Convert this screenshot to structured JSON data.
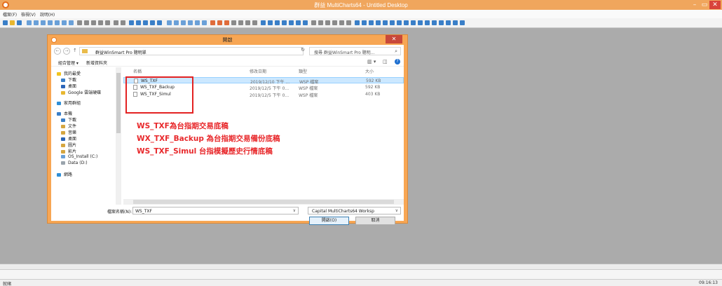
{
  "app": {
    "title": "群益 MultiCharts64 - Untitled Desktop",
    "minimize": "–",
    "maximize": "▭",
    "close": "✕"
  },
  "menubar": [
    "檔案(F)",
    "檢視(V)",
    "說明(H)"
  ],
  "dialog": {
    "title": "開啟",
    "close": "✕",
    "address": {
      "back": "←",
      "forward": "→",
      "up": "↑",
      "path": "群益WinSmart Pro 聰明單",
      "dropdown": "∨",
      "refresh": "↻",
      "search_placeholder": "搜尋 群益WinSmart Pro 聰明...",
      "search_icon": "⌕"
    },
    "command_bar": {
      "organize": "組合管理 ▾",
      "new_folder": "新增資料夾",
      "view_icon": "▥ ▾",
      "pane_icon": "◫",
      "help": "?"
    },
    "nav_items": [
      {
        "label": "我的最愛",
        "icon": "star-icon",
        "color": "#f0c420"
      },
      {
        "label": "下載",
        "icon": "download-icon",
        "color": "#3a7fc8"
      },
      {
        "label": "桌面",
        "icon": "desktop-icon",
        "color": "#2b65b8"
      },
      {
        "label": "Google 雲端硬碟",
        "icon": "drive-icon",
        "color": "#e8b730"
      },
      {
        "label": "家用群組",
        "icon": "homegroup-icon",
        "color": "#2f8fd6"
      },
      {
        "label": "本機",
        "icon": "computer-icon",
        "color": "#3a7fc8"
      },
      {
        "label": "下載",
        "icon": "download-icon",
        "color": "#3a7fc8"
      },
      {
        "label": "文件",
        "icon": "documents-icon",
        "color": "#d5a640"
      },
      {
        "label": "音樂",
        "icon": "music-icon",
        "color": "#d5a640"
      },
      {
        "label": "桌面",
        "icon": "desktop-icon",
        "color": "#2b65b8"
      },
      {
        "label": "圖片",
        "icon": "pictures-icon",
        "color": "#d5a640"
      },
      {
        "label": "影片",
        "icon": "videos-icon",
        "color": "#d5a640"
      },
      {
        "label": "OS_Install (C:)",
        "icon": "drive-c-icon",
        "color": "#6aa0d8"
      },
      {
        "label": "Data (D:)",
        "icon": "drive-d-icon",
        "color": "#9aa4ad"
      },
      {
        "label": "網路",
        "icon": "network-icon",
        "color": "#2f8fd6"
      }
    ],
    "columns": {
      "name": "名稱",
      "date": "修改日期",
      "type": "類型",
      "size": "大小"
    },
    "files": [
      {
        "name": "WS_TXF",
        "date": "2019/12/10 下午 ...",
        "type": "WSP 檔案",
        "size": "592 KB",
        "selected": true
      },
      {
        "name": "WS_TXF_Backup",
        "date": "2019/12/5 下午 0...",
        "type": "WSP 檔案",
        "size": "592 KB",
        "selected": false
      },
      {
        "name": "WS_TXF_Simul",
        "date": "2019/12/5 下午 0...",
        "type": "WSP 檔案",
        "size": "403 KB",
        "selected": false
      }
    ],
    "annotations": [
      "WS_TXF為台指期交易底稿",
      "WX_TXF_Backup 為台指期交易備份底稿",
      "WS_TXF_Simul 台指模擬歷史行情底稿"
    ],
    "filename_label": "檔案名稱(N):",
    "filename_value": "WS_TXF",
    "filetype_value": "Capital MultiCharts64 Worksp",
    "open_label": "開啟(O)",
    "cancel_label": "取消"
  },
  "status": {
    "left": "就緒",
    "right": "09:16:13"
  },
  "colors": {
    "title_bar": "#f0a65d",
    "dialog_frame": "#f7a654",
    "annotation": "#e8282b",
    "highlight_box": "#e32222",
    "selection": "#cce8ff"
  }
}
